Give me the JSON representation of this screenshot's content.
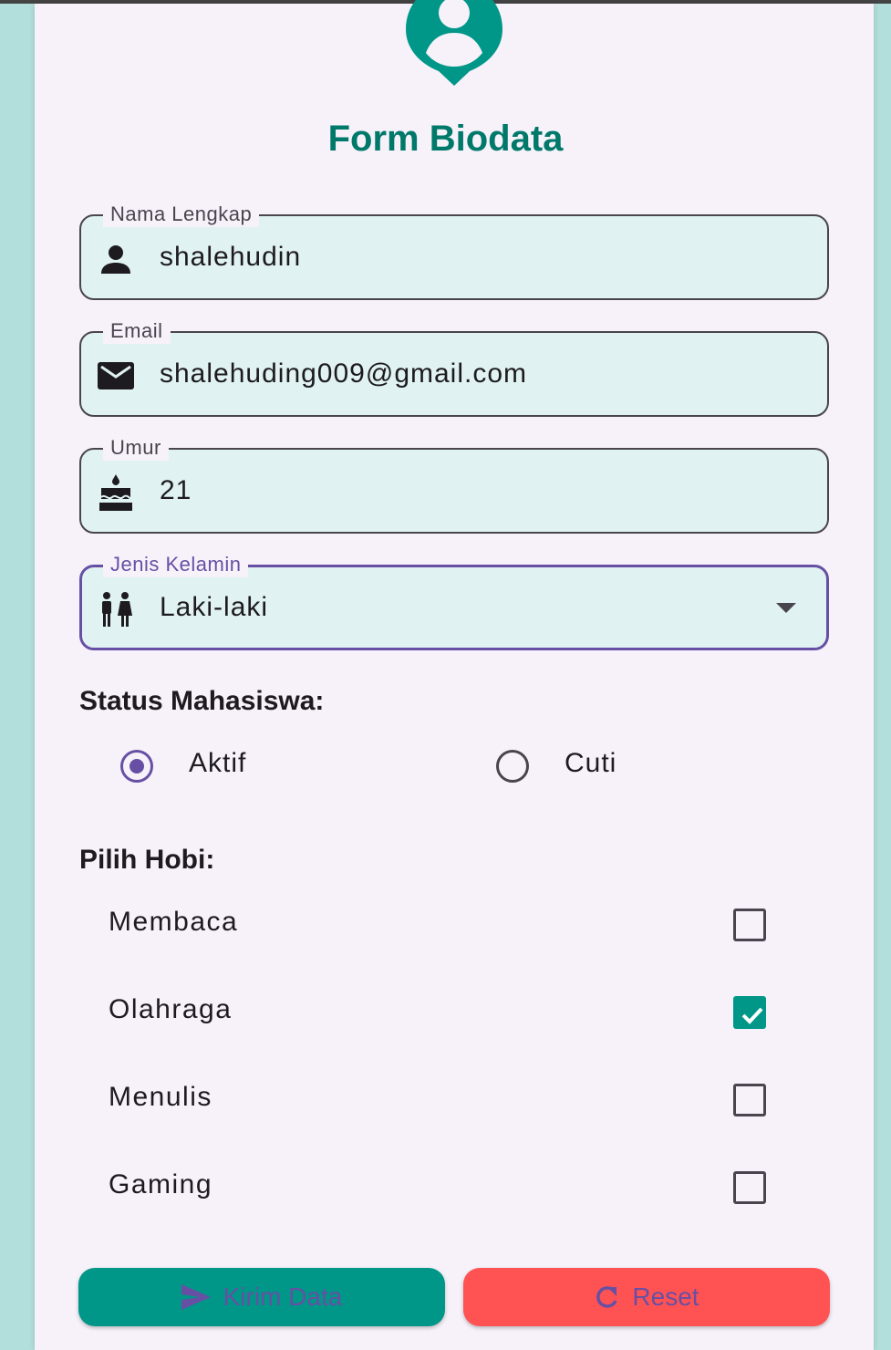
{
  "colors": {
    "accent": "#009688",
    "title": "#00796b",
    "primary": "#6750a4",
    "reset": "#ff5252",
    "field_bg": "#e0f2f1",
    "page_bg": "#b2dfdb"
  },
  "header": {
    "avatar_icon": "person-pin-icon",
    "title": "Form Biodata"
  },
  "form": {
    "nama": {
      "label": "Nama Lengkap",
      "value": "shalehudin",
      "icon": "person-icon"
    },
    "email": {
      "label": "Email",
      "value": "shalehuding009@gmail.com",
      "icon": "mail-icon"
    },
    "umur": {
      "label": "Umur",
      "value": "21",
      "icon": "cake-icon"
    },
    "jenis_kelamin": {
      "label": "Jenis Kelamin",
      "value": "Laki-laki",
      "icon": "wc-icon",
      "focused": true
    }
  },
  "status": {
    "title": "Status Mahasiswa:",
    "options": [
      {
        "label": "Aktif",
        "checked": true
      },
      {
        "label": "Cuti",
        "checked": false
      }
    ]
  },
  "hobi": {
    "title": "Pilih Hobi:",
    "items": [
      {
        "label": "Membaca",
        "checked": false
      },
      {
        "label": "Olahraga",
        "checked": true
      },
      {
        "label": "Menulis",
        "checked": false
      },
      {
        "label": "Gaming",
        "checked": false
      }
    ]
  },
  "buttons": {
    "submit": {
      "label": "Kirim Data",
      "icon": "send-icon"
    },
    "reset": {
      "label": "Reset",
      "icon": "refresh-icon"
    }
  }
}
